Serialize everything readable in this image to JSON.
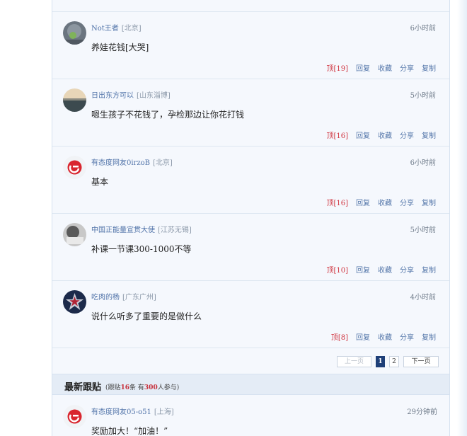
{
  "comments": [
    {
      "author": "Not王者",
      "location": "[北京]",
      "time": "6小时前",
      "text": "养娃花钱[大哭]",
      "votes": "顶[19]",
      "reply": "回复",
      "favorite": "收藏",
      "share": "分享",
      "copy": "复制"
    },
    {
      "author": "日出东方可以",
      "location": "[山东淄博]",
      "time": "5小时前",
      "text": "嗯生孩子不花钱了，孕检那边让你花打钱",
      "votes": "顶[16]",
      "reply": "回复",
      "favorite": "收藏",
      "share": "分享",
      "copy": "复制"
    },
    {
      "author": "有态度网友0irzoB",
      "location": "[北京]",
      "time": "6小时前",
      "text": "基本",
      "votes": "顶[16]",
      "reply": "回复",
      "favorite": "收藏",
      "share": "分享",
      "copy": "复制"
    },
    {
      "author": "中国正能量宣贯大使",
      "location": "[江苏无锡]",
      "time": "5小时前",
      "text": "补课一节课300-1000不等",
      "votes": "顶[10]",
      "reply": "回复",
      "favorite": "收藏",
      "share": "分享",
      "copy": "复制"
    },
    {
      "author": "吃肉的杨",
      "location": "[广东广州]",
      "time": "4小时前",
      "text": "说什么听多了重要的是做什么",
      "votes": "顶[8]",
      "reply": "回复",
      "favorite": "收藏",
      "share": "分享",
      "copy": "复制"
    }
  ],
  "pagination": {
    "prev": "上一页",
    "pages": [
      "1",
      "2"
    ],
    "current": "1",
    "next": "下一页"
  },
  "latest": {
    "title": "最新跟贴",
    "stats_prefix": "(跟贴",
    "post_count": "16",
    "stats_mid": "条 有",
    "participant_count": "300",
    "stats_suffix": "人参与)",
    "comment": {
      "author": "有态度网友05-o51",
      "location": "[上海]",
      "time": "29分钟前",
      "text": "奖励加大！“加油！”"
    }
  },
  "icons": {
    "netease_avatar": "netease-logo-icon"
  },
  "colors": {
    "accent": "#1e3f78",
    "link": "#4f72a8",
    "highlight": "#d0343f"
  }
}
